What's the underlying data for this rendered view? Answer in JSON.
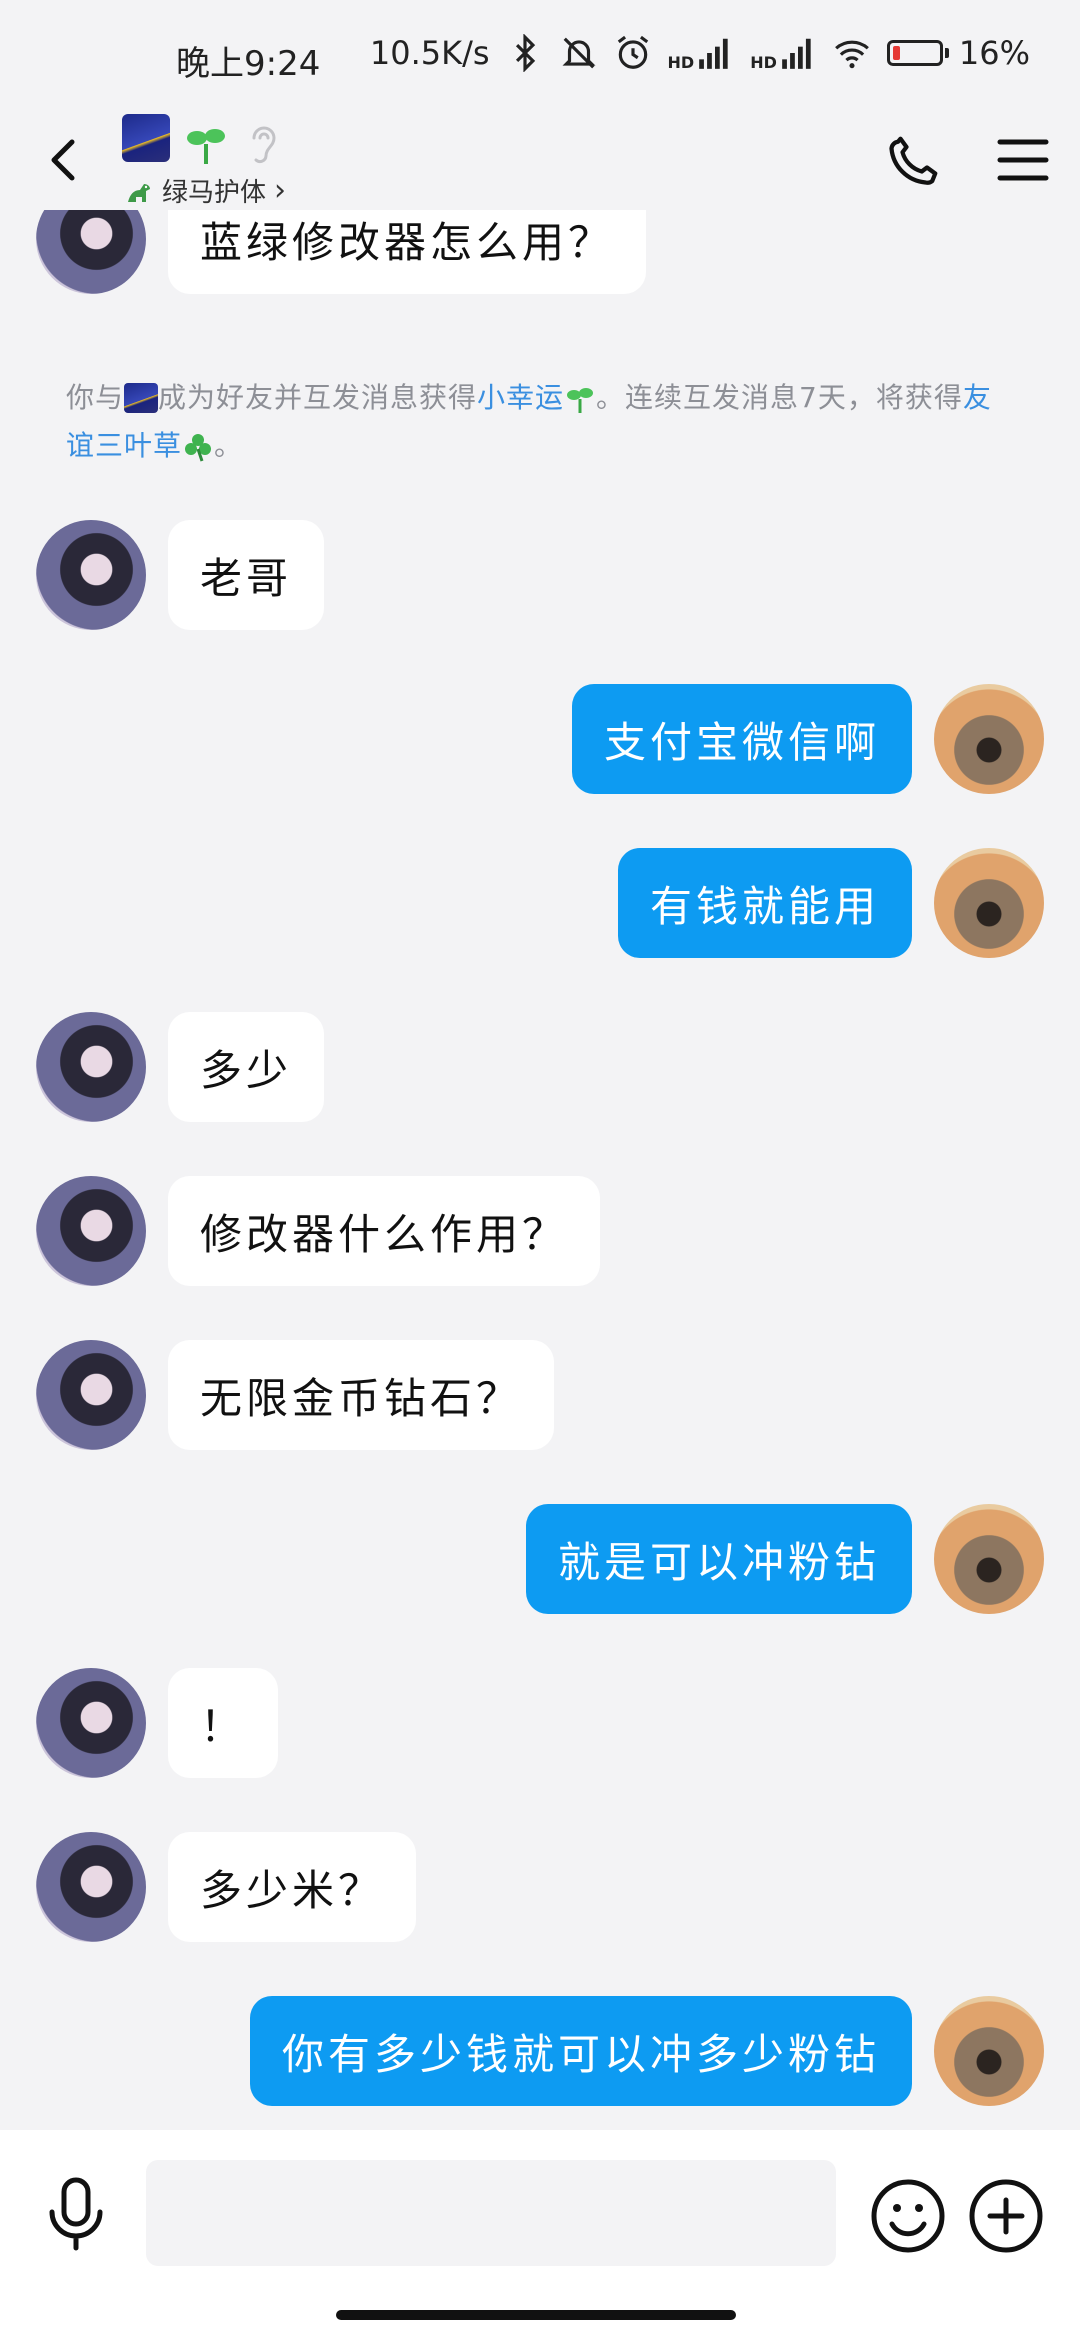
{
  "status_bar": {
    "time": "晚上9:24",
    "net_speed": "10.5K/s",
    "hd1": "HD",
    "hd2": "HD",
    "battery_percent": "16%",
    "battery_level": 0.16,
    "icons": [
      "bluetooth-icon",
      "mute-icon",
      "alarm-icon",
      "signal-icon",
      "signal-icon",
      "wifi-icon",
      "battery-icon"
    ]
  },
  "header": {
    "guard_tag": "绿马护体",
    "guard_chevron": "›",
    "icons": [
      "back-icon",
      "sprout-icon",
      "ear-icon",
      "phone-icon",
      "menu-icon"
    ]
  },
  "chat": {
    "top_message": "蓝绿修改器怎么用？",
    "notice": {
      "part1": "你与",
      "part2": "成为好友并互发消息获得",
      "link1": "小幸运",
      "part3": "。连续互发消息7天，将获得",
      "link2": "友谊三叶草",
      "part4": "。"
    },
    "messages": [
      {
        "side": "in",
        "text": "老哥"
      },
      {
        "side": "out",
        "text": "支付宝微信啊"
      },
      {
        "side": "out",
        "text": "有钱就能用"
      },
      {
        "side": "in",
        "text": "多少"
      },
      {
        "side": "in",
        "text": "修改器什么作用？"
      },
      {
        "side": "in",
        "text": "无限金币钻石？"
      },
      {
        "side": "out",
        "text": "就是可以冲粉钻"
      },
      {
        "side": "in",
        "text": "！"
      },
      {
        "side": "in",
        "text": "多少米？"
      },
      {
        "side": "out",
        "text": "你有多少钱就可以冲多少粉钻"
      }
    ]
  },
  "input_bar": {
    "placeholder": "",
    "icons": [
      "microphone-icon",
      "emoji-icon",
      "plus-icon"
    ]
  },
  "colors": {
    "outgoing_bubble": "#0d9bf2",
    "incoming_bubble": "#ffffff",
    "background": "#f3f3f5",
    "link": "#3a8fe0",
    "battery_low": "#e53935"
  }
}
